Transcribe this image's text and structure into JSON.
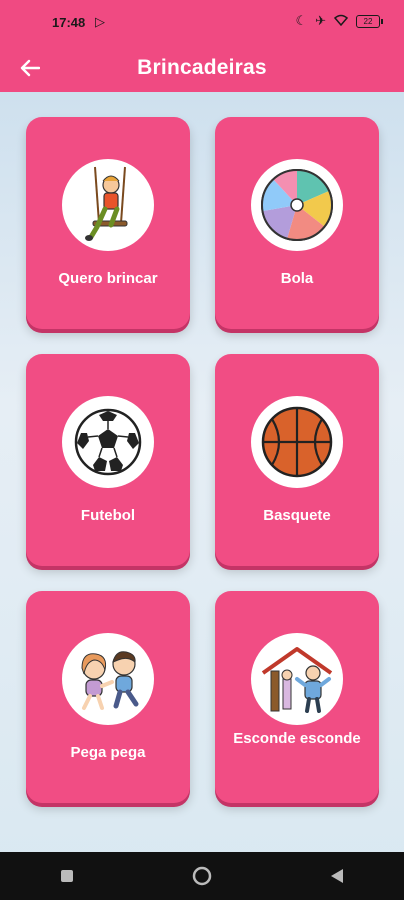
{
  "status_bar": {
    "time": "17:48",
    "battery": "22",
    "icons": [
      "moon-icon",
      "airplane-icon",
      "wifi-icon",
      "battery-icon"
    ]
  },
  "app_bar": {
    "title": "Brincadeiras",
    "back_icon": "arrow-left-icon"
  },
  "cards": [
    {
      "label": "Quero brincar",
      "icon": "swing-child-icon"
    },
    {
      "label": "Bola",
      "icon": "beach-ball-icon"
    },
    {
      "label": "Futebol",
      "icon": "soccer-ball-icon"
    },
    {
      "label": "Basquete",
      "icon": "basketball-icon"
    },
    {
      "label": "Pega pega",
      "icon": "tag-kids-icon"
    },
    {
      "label": "Esconde esconde",
      "icon": "hide-seek-icon"
    }
  ],
  "nav_bar": {
    "buttons": [
      "recents-square-icon",
      "home-circle-icon",
      "back-triangle-icon"
    ]
  },
  "colors": {
    "accent": "#f04a82",
    "card": "#f14d84",
    "background_top": "#c7dcec",
    "background_bottom": "#d9e8f1"
  }
}
